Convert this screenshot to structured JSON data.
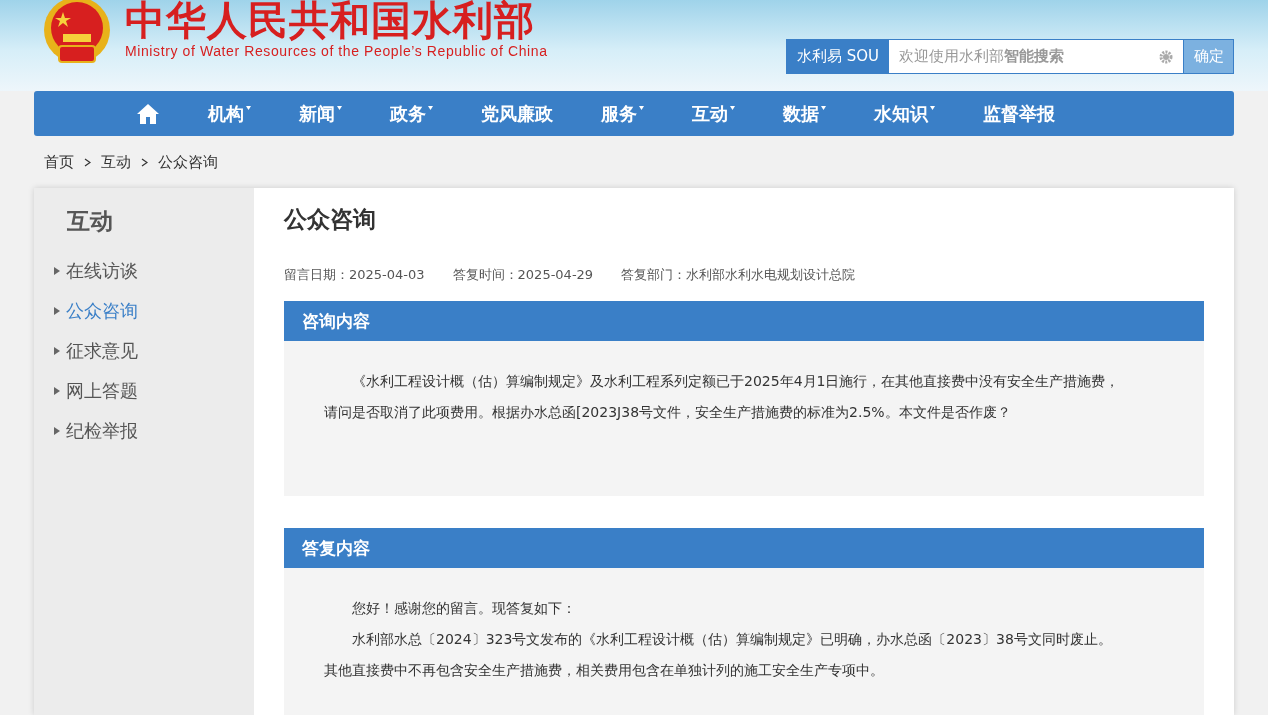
{
  "header": {
    "title": "中华人民共和国水利部",
    "subtitle": "Ministry of Water Resources of the People’s Republic of China"
  },
  "search": {
    "brand": "水利易 SOU",
    "placeholder": "欢迎使用水利部**智能搜索**",
    "button": "确定"
  },
  "nav": [
    {
      "kind": "home"
    },
    {
      "kind": "text",
      "label": "机构",
      "dropdown": true
    },
    {
      "kind": "text",
      "label": "新闻",
      "dropdown": true
    },
    {
      "kind": "text",
      "label": "政务",
      "dropdown": true
    },
    {
      "kind": "text",
      "label": "党风廉政",
      "dropdown": false
    },
    {
      "kind": "text",
      "label": "服务",
      "dropdown": true
    },
    {
      "kind": "text",
      "label": "互动",
      "dropdown": true
    },
    {
      "kind": "text",
      "label": "数据",
      "dropdown": true
    },
    {
      "kind": "text",
      "label": "水知识",
      "dropdown": true
    },
    {
      "kind": "text",
      "label": "监督举报",
      "dropdown": false
    }
  ],
  "breadcrumb": [
    "首页",
    "互动",
    "公众咨询"
  ],
  "sidebar": {
    "title": "互动",
    "items": [
      {
        "label": "在线访谈",
        "selected": false
      },
      {
        "label": "公众咨询",
        "selected": true
      },
      {
        "label": "征求意见",
        "selected": false
      },
      {
        "label": "网上答题",
        "selected": false
      },
      {
        "label": "纪检举报",
        "selected": false
      }
    ]
  },
  "article": {
    "title": "公众咨询",
    "meta": [
      "留言日期：2025-04-03",
      "答复时间：2025-04-29",
      "答复部门：水利部水利水电规划设计总院"
    ],
    "sections": [
      {
        "heading": "咨询内容",
        "paragraphs": [
          "《水利工程设计概（估）算编制规定》及水利工程系列定额已于2025年4月1日施行，在其他直接费中没有安全生产措施费，请问是否取消了此项费用。根据办水总函[2023J38号文件，安全生产措施费的标准为2.5%。本文件是否作废？"
        ]
      },
      {
        "heading": "答复内容",
        "paragraphs": [
          "您好！感谢您的留言。现答复如下：",
          "水利部水总〔2024〕323号文发布的《水利工程设计概（估）算编制规定》已明确，办水总函〔2023〕38号文同时废止。其他直接费中不再包含安全生产措施费，相关费用包含在单独计列的施工安全生产专项中。"
        ]
      }
    ]
  }
}
